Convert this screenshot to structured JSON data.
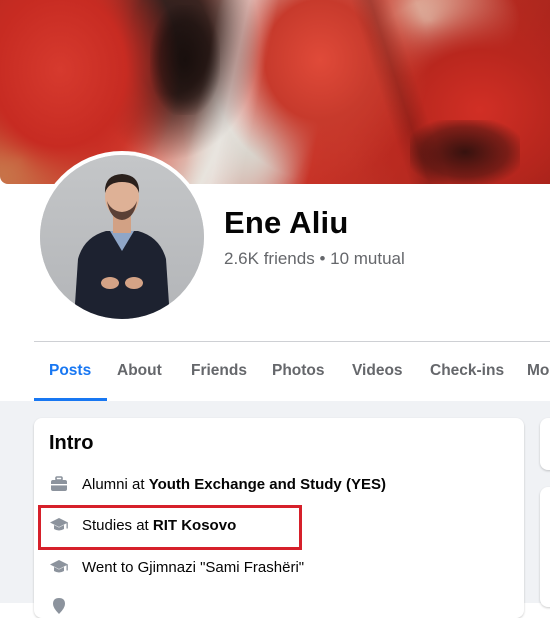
{
  "profile": {
    "name": "Ene Aliu",
    "friends_summary": "2.6K friends • 10 mutual"
  },
  "tabs": [
    {
      "label": "Posts",
      "active": true
    },
    {
      "label": "About",
      "active": false
    },
    {
      "label": "Friends",
      "active": false
    },
    {
      "label": "Photos",
      "active": false
    },
    {
      "label": "Videos",
      "active": false
    },
    {
      "label": "Check-ins",
      "active": false
    },
    {
      "label": "Mo",
      "active": false
    }
  ],
  "intro": {
    "title": "Intro",
    "items": [
      {
        "icon": "briefcase-icon",
        "prefix": "Alumni at ",
        "bold": "Youth Exchange and Study (YES)",
        "highlighted": false
      },
      {
        "icon": "graduation-cap-icon",
        "prefix": "Studies at ",
        "bold": "RIT Kosovo",
        "highlighted": true
      },
      {
        "icon": "graduation-cap-icon",
        "prefix": "Went to Gjimnazi \"Sami Frashëri\"",
        "bold": "",
        "highlighted": false
      }
    ]
  },
  "colors": {
    "accent": "#1877f2",
    "highlight_border": "#d6202a",
    "secondary_text": "#65676b",
    "page_background": "#f0f2f5"
  }
}
